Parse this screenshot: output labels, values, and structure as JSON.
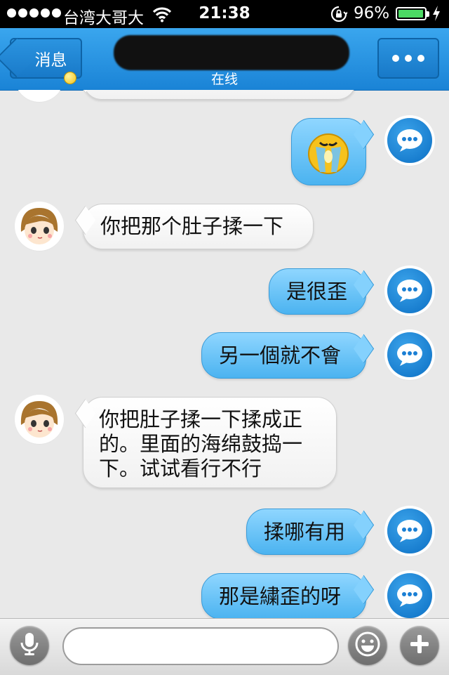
{
  "status_bar": {
    "carrier": "台湾大哥大",
    "time": "21:38",
    "battery_percent": "96%",
    "battery_level": 0.96,
    "icons": [
      "signal-dots-icon",
      "wifi-icon",
      "rotation-lock-icon",
      "battery-icon",
      "charging-icon"
    ]
  },
  "nav": {
    "back_label": "消息",
    "status": "在线",
    "more_icon": "ellipsis-icon"
  },
  "messages": [
    {
      "side": "left",
      "text": "你把那个肚子揉一下"
    },
    {
      "side": "right",
      "text": "是很歪"
    },
    {
      "side": "right",
      "text": "另一個就不會"
    },
    {
      "side": "left",
      "text": "你把肚子揉一下揉成正的。里面的海绵鼓捣一下。试试看行不行"
    },
    {
      "side": "right",
      "text": "揉哪有用"
    },
    {
      "side": "right",
      "text": "那是繍歪的呀"
    }
  ],
  "input_bar": {
    "placeholder": "",
    "icons": [
      "microphone-icon",
      "smiley-icon",
      "plus-icon"
    ]
  },
  "colors": {
    "nav_blue": "#1f8ddc",
    "incoming_bubble": "#ffffff",
    "outgoing_bubble": "#63c2f6",
    "chat_background": "#e9e9e9"
  }
}
